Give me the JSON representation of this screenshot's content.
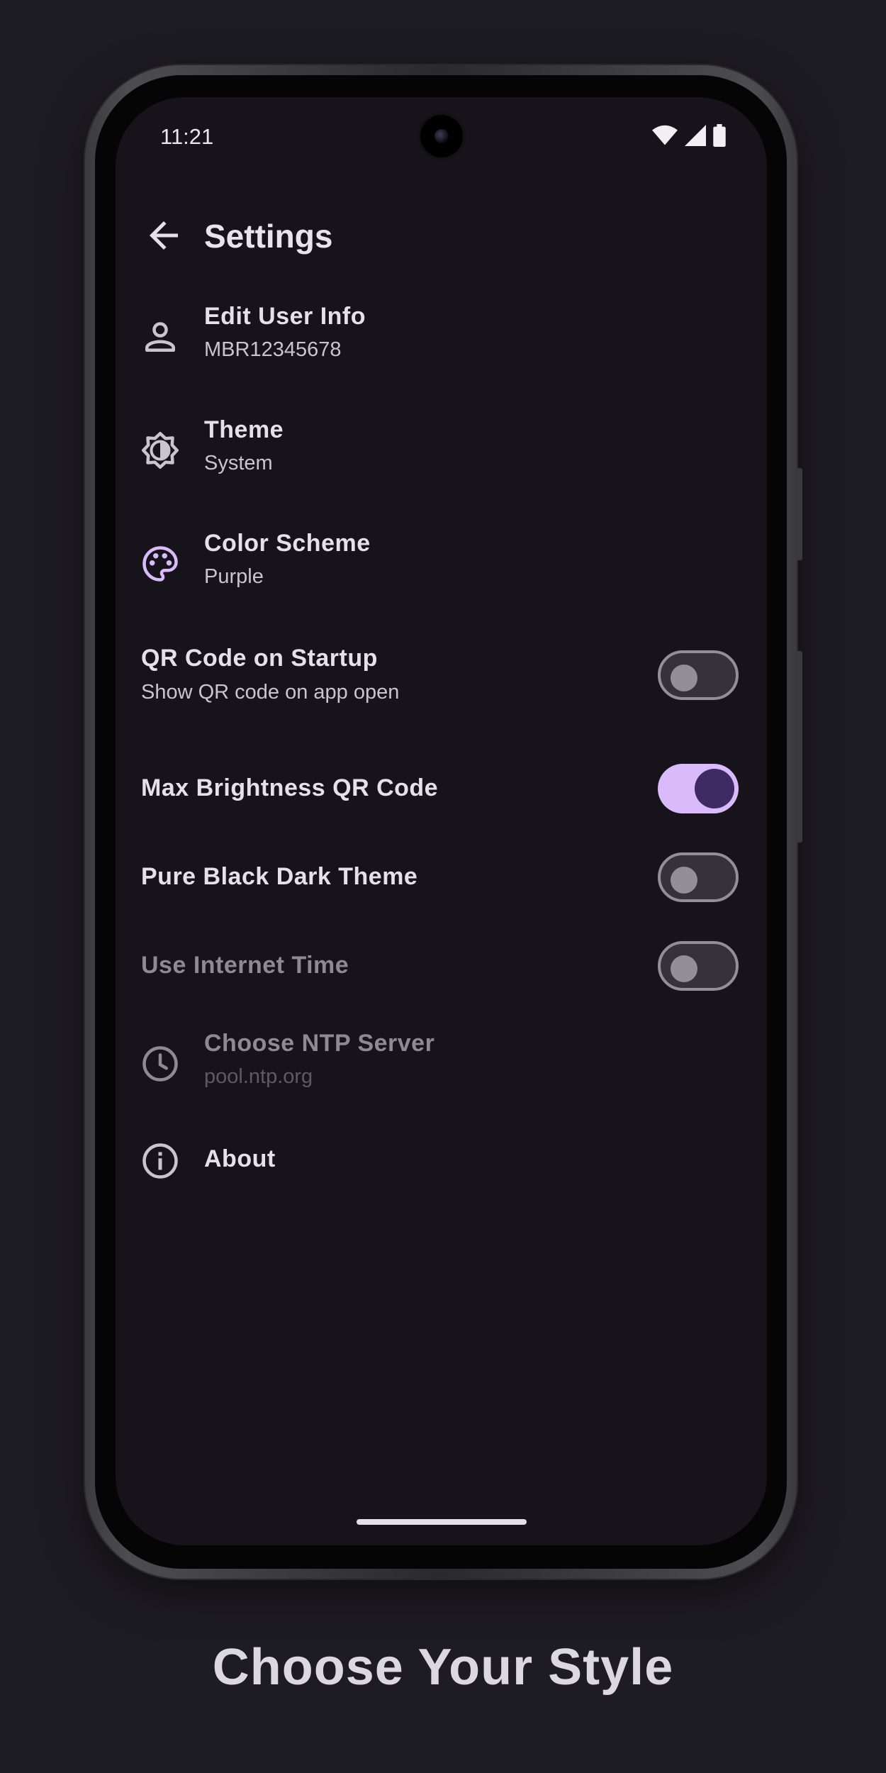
{
  "status_bar": {
    "time": "11:21",
    "icons": [
      "wifi-icon",
      "signal-icon",
      "battery-icon"
    ]
  },
  "app_bar": {
    "title": "Settings",
    "back_icon": "arrow-back-icon"
  },
  "settings": {
    "edit_user": {
      "label": "Edit User Info",
      "value": "MBR12345678",
      "icon": "person-icon"
    },
    "theme": {
      "label": "Theme",
      "value": "System",
      "icon": "brightness-icon"
    },
    "color_scheme": {
      "label": "Color Scheme",
      "value": "Purple",
      "icon": "palette-icon"
    },
    "qr_startup": {
      "label": "QR Code on Startup",
      "description": "Show QR code on app open",
      "enabled": false
    },
    "max_brightness": {
      "label": "Max Brightness QR Code",
      "enabled": true
    },
    "pure_black": {
      "label": "Pure Black Dark Theme",
      "enabled": false
    },
    "internet_time": {
      "label": "Use Internet Time",
      "enabled": false
    },
    "ntp_server": {
      "label": "Choose NTP Server",
      "value": "pool.ntp.org",
      "icon": "clock-icon"
    },
    "about": {
      "label": "About",
      "icon": "info-icon"
    }
  },
  "colors": {
    "accent": "#d9bafa",
    "palette_icon": "#d9bafa",
    "background": "#16141a"
  },
  "tagline": "Choose Your Style"
}
